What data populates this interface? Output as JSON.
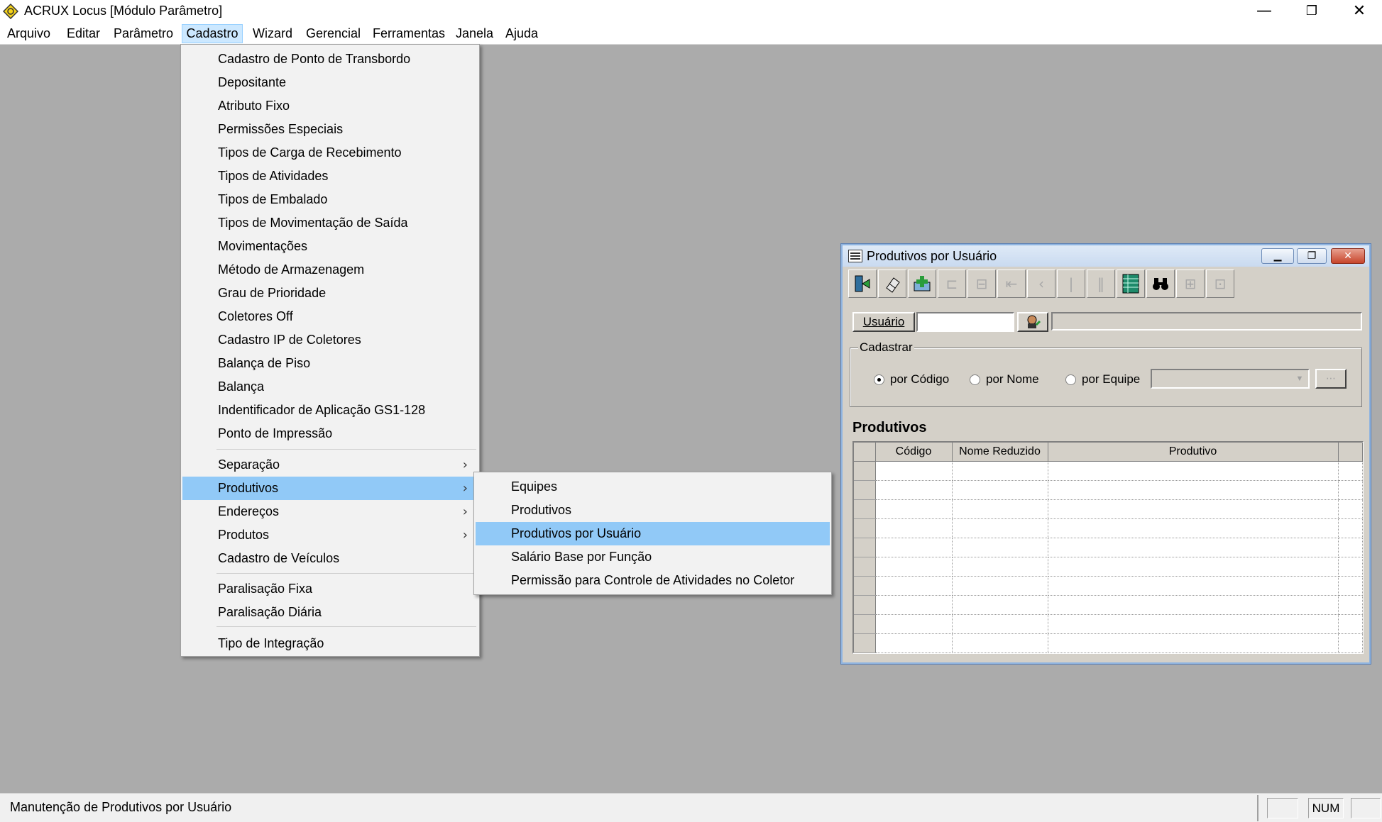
{
  "window": {
    "title": "ACRUX Locus [Módulo Parâmetro]",
    "minimize_glyph": "—",
    "maximize_glyph": "❐",
    "close_glyph": "✕"
  },
  "menubar": [
    {
      "label": "Arquivo"
    },
    {
      "label": "Editar"
    },
    {
      "label": "Parâmetro"
    },
    {
      "label": "Cadastro"
    },
    {
      "label": "Wizard"
    },
    {
      "label": "Gerencial"
    },
    {
      "label": "Ferramentas"
    },
    {
      "label": "Janela"
    },
    {
      "label": "Ajuda"
    }
  ],
  "cadastro_menu": [
    "Cadastro de Ponto de Transbordo",
    "Depositante",
    "Atributo Fixo",
    "Permissões Especiais",
    "Tipos de Carga de Recebimento",
    "Tipos de Atividades",
    "Tipos de Embalado",
    "Tipos de Movimentação de Saída",
    "Movimentações",
    "Método de Armazenagem",
    "Grau de Prioridade",
    "Coletores Off",
    "Cadastro IP de Coletores",
    "Balança de Piso",
    "Balança",
    "Indentificador de Aplicação GS1-128",
    "Ponto de Impressão",
    "Separação",
    "Produtivos",
    "Endereços",
    "Produtos",
    "Cadastro de Veículos",
    "Paralisação Fixa",
    "Paralisação Diária",
    "Tipo de Integração"
  ],
  "submenu_arrow": "›",
  "produtivos_submenu": [
    "Equipes",
    "Produtivos",
    "Produtivos por Usuário",
    "Salário Base por Função",
    "Permissão para Controle de Atividades no Coletor"
  ],
  "child_window": {
    "title": "Produtivos por Usuário",
    "usuario_button": "Usuário",
    "usuario_value": "",
    "group_label": "Cadastrar",
    "radios": [
      "por Código",
      "por Nome",
      "por Equipe"
    ],
    "selected_radio": "por Código",
    "section_title": "Produtivos",
    "columns": [
      "Código",
      "Nome Reduzido",
      "Produtivo"
    ],
    "rows": 10
  },
  "statusbar": {
    "message": "Manutenção de Produtivos por Usuário",
    "num": "NUM"
  },
  "colors": {
    "menu_highlight": "#91c9f7",
    "desktop": "#ababab",
    "active_menu": "#cce8ff"
  }
}
